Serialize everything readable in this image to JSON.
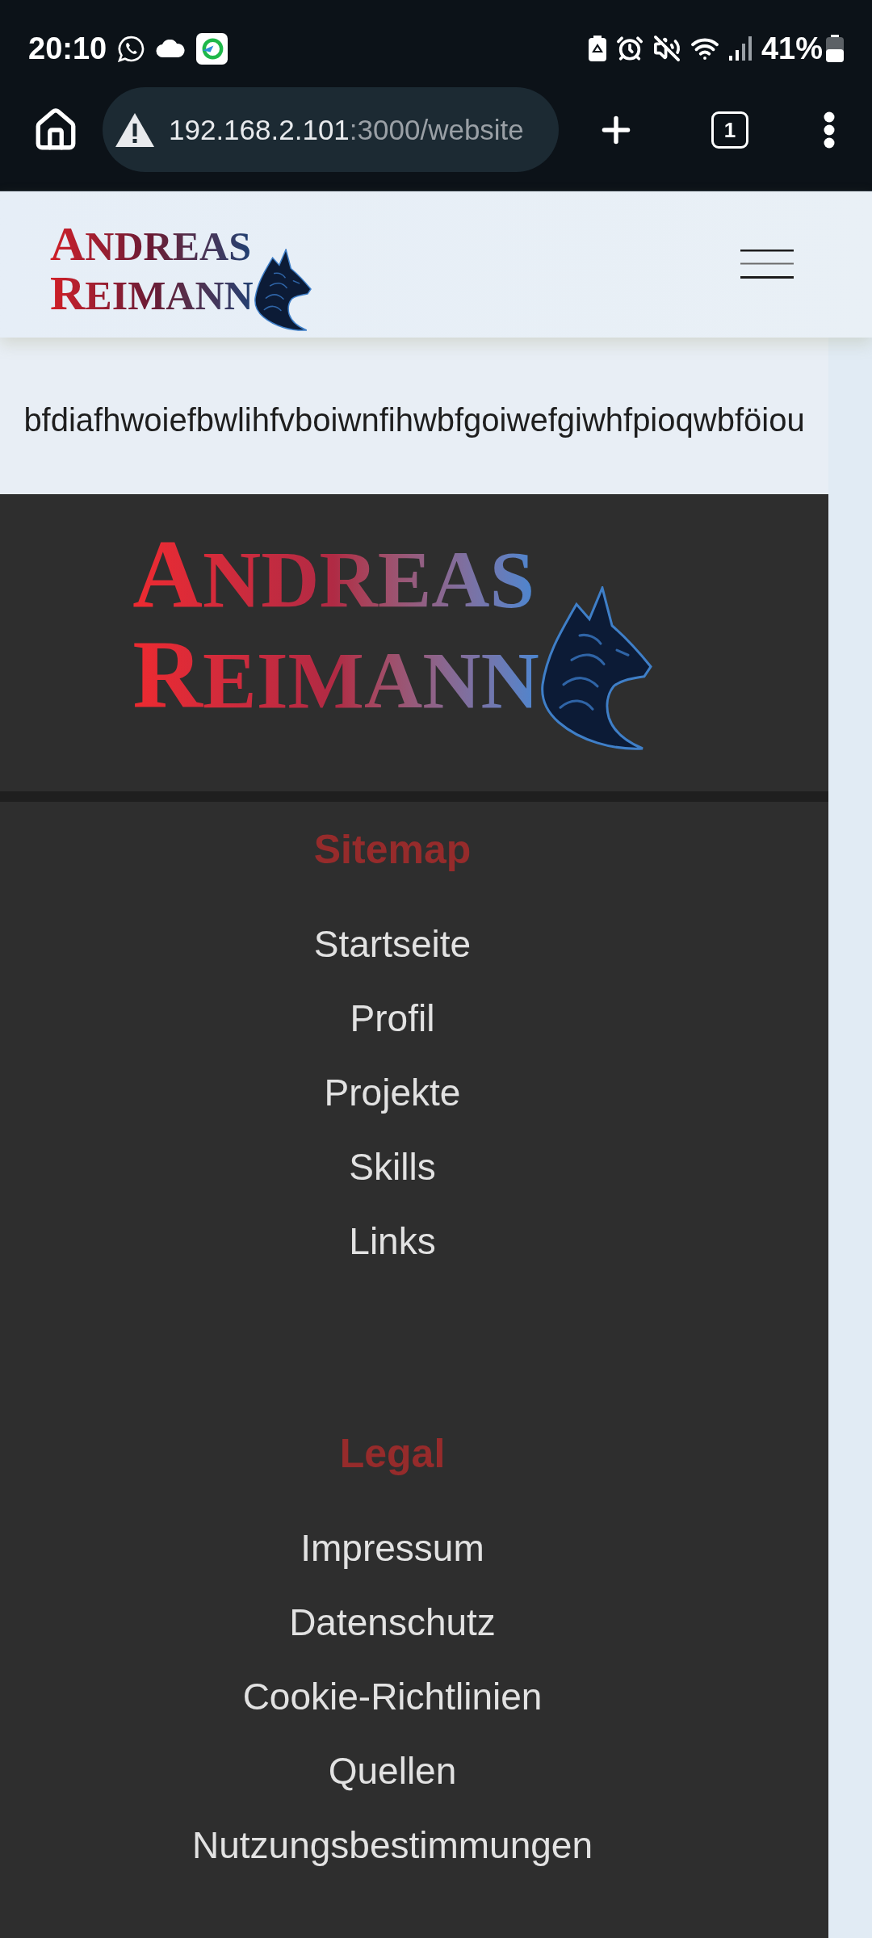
{
  "status_bar": {
    "time": "20:10",
    "battery": "41%"
  },
  "browser_bar": {
    "url_host": "192.168.2.101",
    "url_path": ":3000/website",
    "tab_count": "1"
  },
  "header": {
    "logo_lines": [
      "ANDREAS",
      "REIMANN"
    ]
  },
  "content": {
    "text": "bfdiafhwoiefbwlihfvboiwnfihwbfgoiwefgiwhfpioqwbföiou"
  },
  "footer": {
    "logo_lines": [
      "ANDREAS",
      "REIMANN"
    ],
    "sections": [
      {
        "title": "Sitemap",
        "links": [
          "Startseite",
          "Profil",
          "Projekte",
          "Skills",
          "Links"
        ]
      },
      {
        "title": "Legal",
        "links": [
          "Impressum",
          "Datenschutz",
          "Cookie-Richtlinien",
          "Quellen",
          "Nutzungsbestimmungen"
        ]
      }
    ]
  }
}
